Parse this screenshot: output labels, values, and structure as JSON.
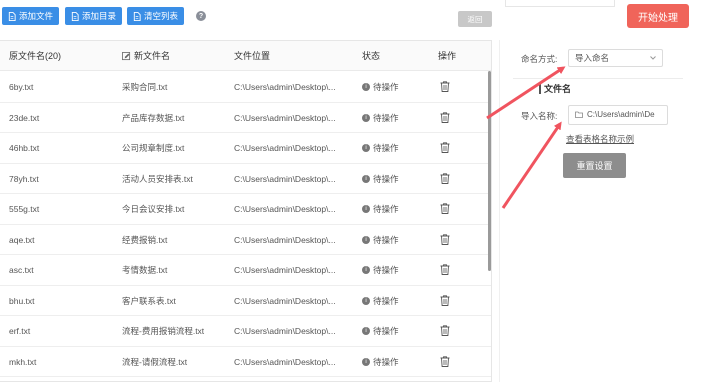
{
  "toolbar": {
    "add_file": "添加文件",
    "add_folder": "添加目录",
    "clear_list": "清空列表",
    "help": "?",
    "return": "返回",
    "start": "开始处理"
  },
  "table": {
    "headers": {
      "orig_name": "原文件名(20)",
      "new_name": "新文件名",
      "location": "文件位置",
      "status": "状态",
      "action": "操作"
    },
    "rows": [
      {
        "orig": "6by.txt",
        "new": "采购合同.txt",
        "loc": "C:\\Users\\admin\\Desktop\\...",
        "status": "待操作"
      },
      {
        "orig": "23de.txt",
        "new": "产品库存数据.txt",
        "loc": "C:\\Users\\admin\\Desktop\\...",
        "status": "待操作"
      },
      {
        "orig": "46hb.txt",
        "new": "公司规章制度.txt",
        "loc": "C:\\Users\\admin\\Desktop\\...",
        "status": "待操作"
      },
      {
        "orig": "78yh.txt",
        "new": "活动人员安排表.txt",
        "loc": "C:\\Users\\admin\\Desktop\\...",
        "status": "待操作"
      },
      {
        "orig": "555g.txt",
        "new": "今日会议安排.txt",
        "loc": "C:\\Users\\admin\\Desktop\\...",
        "status": "待操作"
      },
      {
        "orig": "aqe.txt",
        "new": "经费报销.txt",
        "loc": "C:\\Users\\admin\\Desktop\\...",
        "status": "待操作"
      },
      {
        "orig": "asc.txt",
        "new": "考情数据.txt",
        "loc": "C:\\Users\\admin\\Desktop\\...",
        "status": "待操作"
      },
      {
        "orig": "bhu.txt",
        "new": "客户联系表.txt",
        "loc": "C:\\Users\\admin\\Desktop\\...",
        "status": "待操作"
      },
      {
        "orig": "erf.txt",
        "new": "流程-费用报销流程.txt",
        "loc": "C:\\Users\\admin\\Desktop\\...",
        "status": "待操作"
      },
      {
        "orig": "mkh.txt",
        "new": "流程-请假流程.txt",
        "loc": "C:\\Users\\admin\\Desktop\\...",
        "status": "待操作"
      }
    ]
  },
  "settings": {
    "naming_label": "命名方式:",
    "naming_value": "导入命名",
    "section_title": "文件名",
    "import_label": "导入名称:",
    "import_value": "C:\\Users\\admin\\De",
    "example_link": "查看表格名称示例",
    "reset": "重置设置"
  },
  "colors": {
    "primary": "#3a8ee6",
    "start": "#f0645a",
    "arrow": "#f0545f",
    "reset": "#8d8d8d"
  }
}
